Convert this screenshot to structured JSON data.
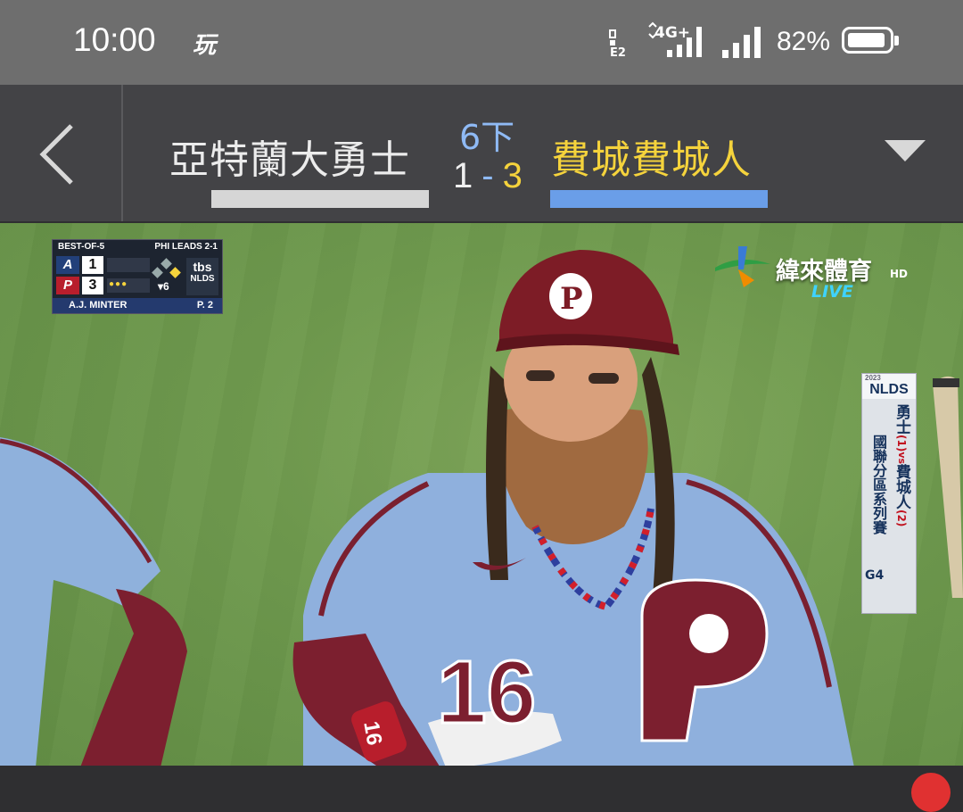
{
  "status_bar": {
    "time": "10:00",
    "app_icon_text": "玩",
    "network": "4G+",
    "battery_percent": "82%",
    "battery_level": 0.82
  },
  "header": {
    "away_team": "亞特蘭大勇士",
    "home_team": "費城費城人",
    "inning": "6下",
    "away_score": "1",
    "separator": "-",
    "home_score": "3",
    "back_icon": "chevron-left-icon",
    "dropdown_icon": "triangle-down-icon",
    "colors": {
      "away": "#ececec",
      "home": "#f5d33c",
      "inning": "#8fbaf5",
      "home_bar": "#6a9ee8",
      "away_bar": "#d6d6d6"
    }
  },
  "scorebug": {
    "series_format": "BEST-OF-5",
    "series_status": "PHI LEADS 2-1",
    "away_logo": "A",
    "away_runs": "1",
    "home_logo": "P",
    "home_runs": "3",
    "inning": "6",
    "network": "tbs",
    "network_sub": "NLDS",
    "pitcher": "A.J. MINTER",
    "pitch_count": "P. 2"
  },
  "channel": {
    "name": "緯來體育",
    "hd": "HD",
    "live": "LIVE"
  },
  "nlds_banner": {
    "year": "2023",
    "title": "NLDS",
    "left_text": "國聯分區系列賽",
    "game": "G4",
    "team1": "勇士",
    "team1_seed": "(1)",
    "vs": "vs",
    "team2": "費城人",
    "team2_seed": "(2)"
  },
  "player": {
    "jersey_number": "16",
    "wristband_number": "16"
  }
}
